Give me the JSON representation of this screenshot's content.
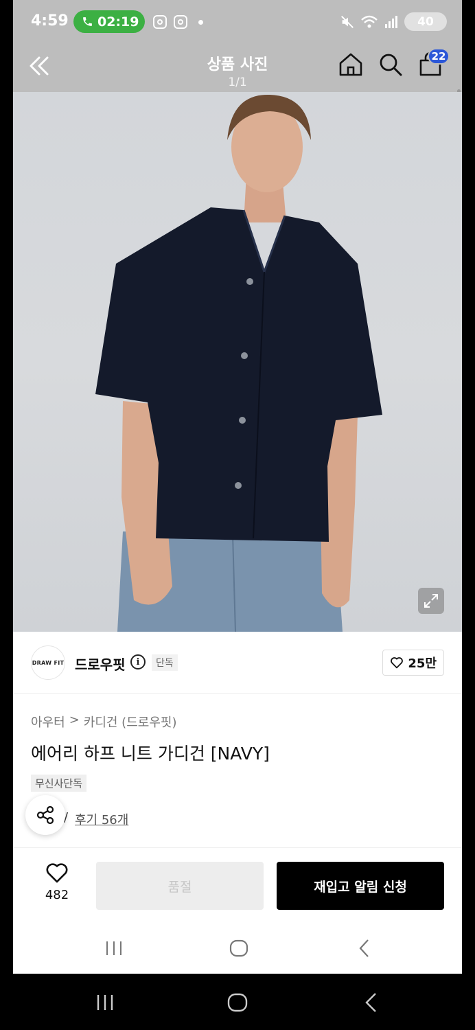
{
  "status_bar": {
    "time": "4:59",
    "call_timer": "02:19",
    "battery": "40"
  },
  "header": {
    "title": "상품 사진",
    "page_indicator": "1/1",
    "cart_count": "22"
  },
  "brand": {
    "logo_text": "DRAW FIT",
    "name": "드로우핏",
    "exclusive_tag": "단독",
    "like_count": "25만"
  },
  "product": {
    "breadcrumb": [
      "아우터",
      ">",
      "카디건 (드로우핏)"
    ],
    "name": "에어리 하프 니트 가디건 [NAVY]",
    "tag": "무신사단독",
    "rating_partial": "/",
    "reviews": "후기 56개"
  },
  "actions": {
    "heart_count": "482",
    "soldout_label": "품절",
    "restock_label": "재입고 알림 신청"
  },
  "icons": {
    "back": "double-chevron-left-icon",
    "home": "home-icon",
    "search": "search-icon",
    "cart": "shopping-bag-icon",
    "expand": "expand-icon",
    "share": "share-icon",
    "heart": "heart-icon"
  }
}
